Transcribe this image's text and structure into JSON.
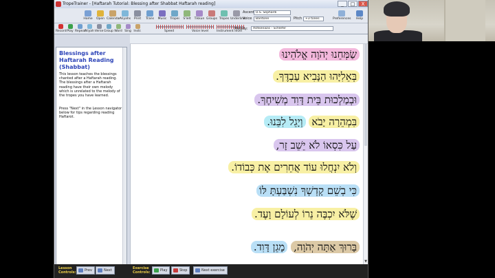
{
  "window": {
    "title": "TropeTrainer - [Haftarah Tutorial: Blessing after Shabbat Haftarah reading]",
    "minimize": "_",
    "maximize": "□",
    "close": "X"
  },
  "toolbar1": {
    "buttons": [
      {
        "label": "Home",
        "icon": "home-icon"
      },
      {
        "label": "Open",
        "icon": "open-icon"
      },
      {
        "label": "Calendar",
        "icon": "calendar-icon"
      },
      {
        "label": "Aliyahs",
        "icon": "aliyahs-icon"
      },
      {
        "label": "Print",
        "icon": "print-icon"
      },
      {
        "label": "Trans",
        "icon": "trans-icon"
      },
      {
        "label": "Music",
        "icon": "music-icon"
      },
      {
        "label": "Tropei",
        "icon": "tropei-icon"
      },
      {
        "label": "S'lelt",
        "icon": "slelt-icon"
      },
      {
        "label": "Tikkun",
        "icon": "tikkun-icon"
      },
      {
        "label": "Groups",
        "icon": "groups-icon"
      },
      {
        "label": "Tropes",
        "icon": "tropes-icon"
      },
      {
        "label": "Underline",
        "icon": "underline-icon"
      }
    ],
    "ascent_label": "Ascent",
    "ascent_value": "U.S. Sephardi",
    "voice_label": "Voice",
    "voice_value": "Baritone",
    "pitch_label": "Pitch",
    "pitch_value": "+3 tones",
    "preferences": "Preferences",
    "help": "Help"
  },
  "toolbar2": {
    "buttons": [
      {
        "label": "Record",
        "icon": "record-icon"
      },
      {
        "label": "Play",
        "icon": "play-icon"
      },
      {
        "label": "Repeat",
        "icon": "repeat-icon"
      },
      {
        "label": "Aliyah",
        "icon": "aliyah-icon"
      },
      {
        "label": "Verse",
        "icon": "verse-icon"
      },
      {
        "label": "Group",
        "icon": "group-icon"
      },
      {
        "label": "Word",
        "icon": "word-icon"
      },
      {
        "label": "Sing",
        "icon": "sing-icon"
      },
      {
        "label": "Instr.",
        "icon": "instrument-icon"
      }
    ],
    "speed_label": "Speed",
    "voice_level_label": "Voice level",
    "instrument_level_label": "Instrument level",
    "melody_label": "Melody:",
    "melody_value": "Ashkenazic - Schlefer"
  },
  "lesson": {
    "title": "Blessings after Haftarah Reading (Shabbat)",
    "paragraph1": "This lesson teaches the blessings chanted after a Haftarah reading. The blessings after a Haftarah reading have their own melody which is unrelated to the melody of the tropes you have learned.",
    "paragraph2": "Press \"Next\" in the Lesson navigator below for tips regarding reading Haftarot."
  },
  "text_lines": [
    [
      {
        "t": "שַׂמְּחֵנוּ יְהֹוָה אֱלֹהֵינוּ",
        "c": "pink"
      }
    ],
    [
      {
        "t": "בְּאֵלִיָּהוּ הַנָּבִיא עַבְדֶּךָ.",
        "c": "yellow"
      }
    ],
    [
      {
        "t": "וּבְמַלְכוּת בֵּית דָּוִד מְשִׁיחֶךָ.",
        "c": "purple"
      }
    ],
    [
      {
        "t": "בִּמְהֵרָה יָבֹא",
        "c": "yellow"
      },
      {
        "t": "וְיָגֵל לִבֵּנוּ.",
        "c": "cyan"
      }
    ],
    [
      {
        "t": "עַל כִּסְאוֹ לֹא יֵשֵׁב זָר,",
        "c": "purple"
      }
    ],
    [
      {
        "t": "וְלֹא יִנְחֲלוּ עוֹד אֲחֵרִים אֶת כְּבוֹדוֹ.",
        "c": "yellow"
      }
    ],
    [
      {
        "t": "כִּי בְשֵׁם קָדְשְׁךָ נִשְׁבַּעְתָּ לּוֹ",
        "c": "ltblue"
      }
    ],
    [
      {
        "t": "שֶׁלֹּא יִכְבֶּה נֵרוֹ לְעוֹלָם וָעֶד.",
        "c": "yellow"
      }
    ],
    [
      {
        "t": "בָּרוּךְ אַתָּה יְהֹוָה,",
        "c": "tan"
      },
      {
        "t": "מָגֵן דָּוִד.",
        "c": "ltblue"
      }
    ]
  ],
  "lesson_controls": {
    "label": "Lesson Controls:",
    "prev": "Prev",
    "next": "Next"
  },
  "exercise_controls": {
    "label": "Exercise Controls:",
    "play": "Play",
    "stop": "Stop",
    "next_exercise": "Next exercise"
  }
}
